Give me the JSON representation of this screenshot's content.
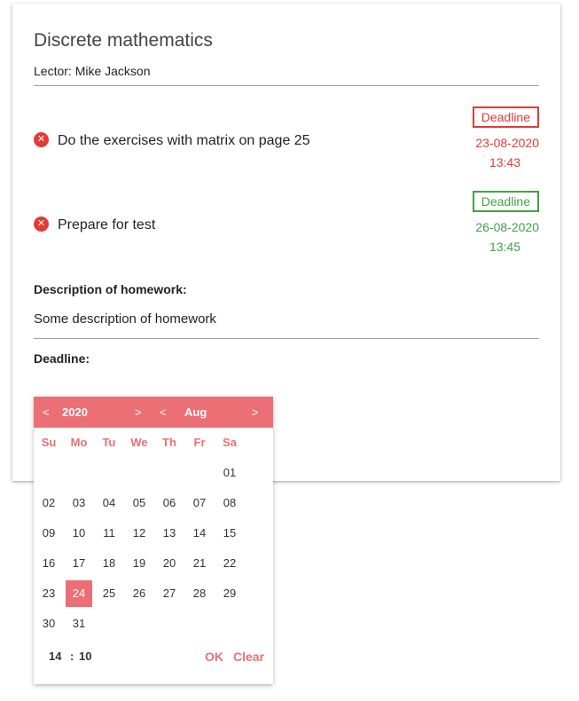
{
  "course": {
    "title": "Discrete mathematics",
    "lector": "Lector: Mike Jackson"
  },
  "tasks": [
    {
      "text": "Do the exercises with matrix on page 25",
      "badge": "Deadline",
      "date": "23-08-2020",
      "time": "13:43",
      "status_color": "#e53935",
      "icon": "close-circle-icon"
    },
    {
      "text": "Prepare for test",
      "badge": "Deadline",
      "date": "26-08-2020",
      "time": "13:45",
      "status_color": "#43a047",
      "icon": "close-circle-icon"
    }
  ],
  "homework": {
    "description_label": "Description of homework:",
    "description": "Some description of homework",
    "deadline_label": "Deadline:"
  },
  "picker": {
    "accent": "#ec6f76",
    "prev_symbol": "<",
    "next_symbol": ">",
    "year": "2020",
    "month": "Aug",
    "weekdays": [
      "Su",
      "Mo",
      "Tu",
      "We",
      "Th",
      "Fr",
      "Sa"
    ],
    "weeks": [
      [
        "",
        "",
        "",
        "",
        "",
        "",
        "01"
      ],
      [
        "02",
        "03",
        "04",
        "05",
        "06",
        "07",
        "08"
      ],
      [
        "09",
        "10",
        "11",
        "12",
        "13",
        "14",
        "15"
      ],
      [
        "16",
        "17",
        "18",
        "19",
        "20",
        "21",
        "22"
      ],
      [
        "23",
        "24",
        "25",
        "26",
        "27",
        "28",
        "29"
      ],
      [
        "30",
        "31",
        "",
        "",
        "",
        "",
        ""
      ]
    ],
    "selected_day": "24",
    "hour": "14",
    "time_separator": ":",
    "minute": "10",
    "ok_label": "OK",
    "clear_label": "Clear"
  }
}
